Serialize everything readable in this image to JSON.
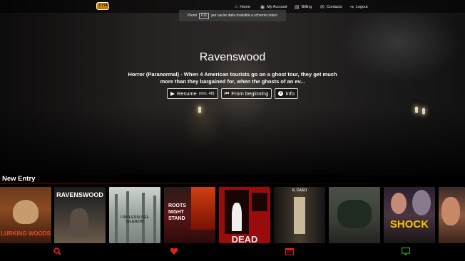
{
  "logo": {
    "text": "SYNC"
  },
  "nav": {
    "home": "Home",
    "account": "My Account",
    "billing": "Billing",
    "contacts": "Contacts",
    "logout": "Logout"
  },
  "toast": {
    "before": "Premi",
    "key": "F11",
    "after": "per uscire dalla modalità a schermo intero"
  },
  "hero": {
    "title": "Ravenswood",
    "description": "Horror (Paranormal) - When 4 American tourists go on a ghost tour, they get much more than they bargained for, when the ghosts of an ev...",
    "resume_label": "Resume",
    "resume_minute": "(min. 48)",
    "begin_label": "From beginning",
    "info_label": "Info"
  },
  "section": {
    "title": "New Entry"
  },
  "posters": [
    {
      "title": "LURKING WOODS",
      "accent": "#c0392b"
    },
    {
      "title": "RAVENSWOOD",
      "accent": "#ffffff"
    },
    {
      "title": "I RIFLESSI DEL SILENZIO",
      "accent": "#dddddd"
    },
    {
      "title": "ROOTS NIGHT STAND",
      "accent": "#ffffff"
    },
    {
      "title": "DEAD",
      "accent": "#e8e8e8"
    },
    {
      "title": "IL CASO",
      "accent": "#dddddd"
    },
    {
      "title": "",
      "accent": "#888888"
    },
    {
      "title": "SHOCK",
      "accent": "#f5c400"
    },
    {
      "title": "",
      "accent": "#aaaaaa"
    }
  ],
  "bottom_nav": [
    {
      "icon": "search-icon",
      "color": "#e02020"
    },
    {
      "icon": "heart-icon",
      "color": "#e02020"
    },
    {
      "icon": "calendar-icon",
      "color": "#e02020"
    },
    {
      "icon": "tv-icon",
      "color": "#2e9a2e"
    }
  ]
}
